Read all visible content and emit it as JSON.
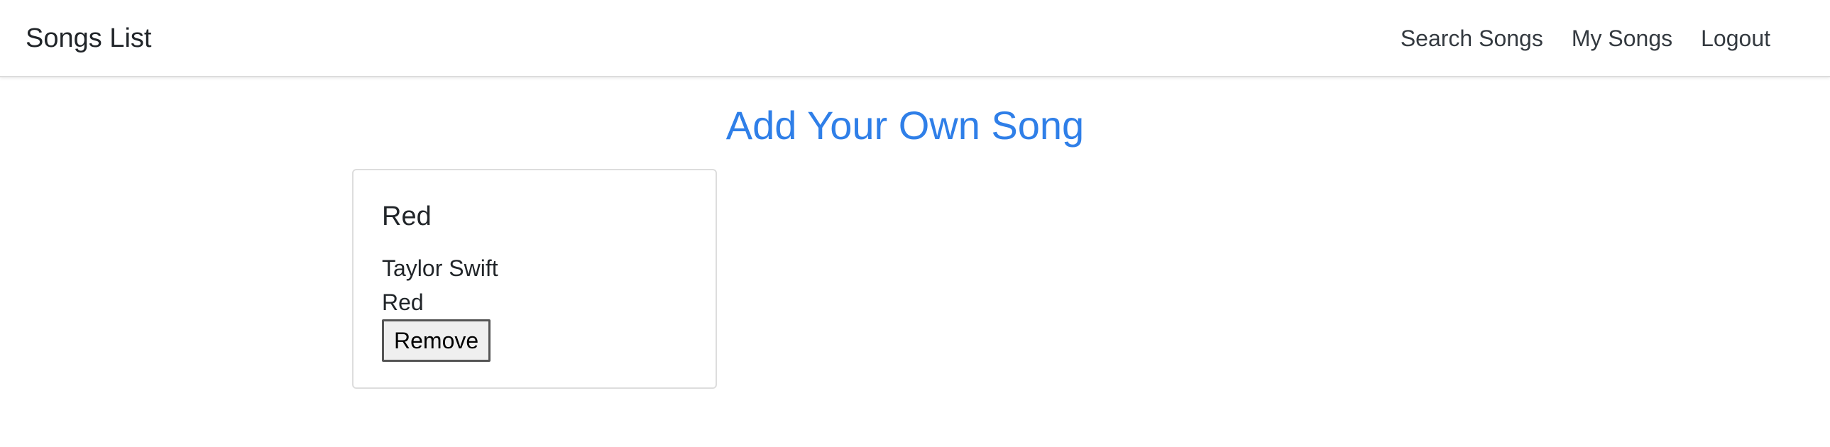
{
  "navbar": {
    "brand": "Songs List",
    "links": [
      {
        "label": "Search Songs"
      },
      {
        "label": "My Songs"
      },
      {
        "label": "Logout"
      }
    ]
  },
  "main": {
    "title": "Add Your Own Song",
    "songs": [
      {
        "title": "Red",
        "artist": "Taylor Swift",
        "album": "Red",
        "remove_label": "Remove"
      }
    ]
  },
  "colors": {
    "title_accent": "#2f7fe8",
    "navbar_border": "#dcdcdc",
    "card_border": "#dddddd"
  }
}
